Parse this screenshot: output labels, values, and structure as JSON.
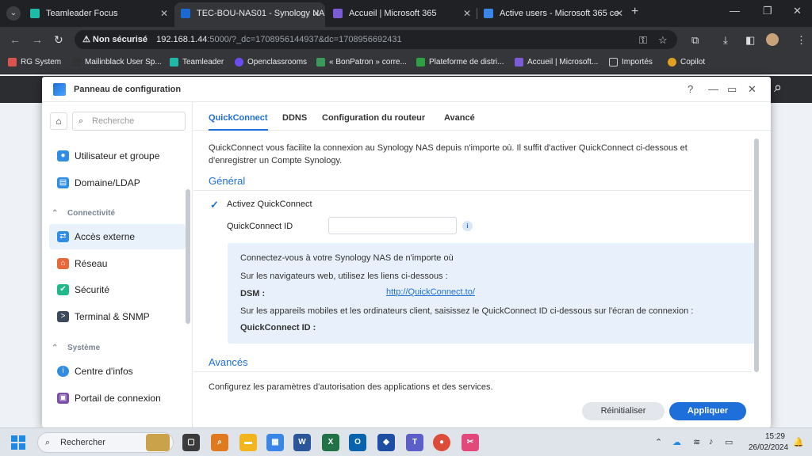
{
  "browser": {
    "tabs": [
      {
        "title": "Teamleader Focus",
        "color": "#1fb9a8"
      },
      {
        "title": "TEC-BOU-NAS01 - Synology NA",
        "color": "#1b6ad4"
      },
      {
        "title": "Accueil | Microsoft 365",
        "color": "#7b5cd6"
      },
      {
        "title": "Active users - Microsoft 365 ce",
        "color": "#3a86e8"
      }
    ],
    "url_warning": "Non sécurisé",
    "url_host": "192.168.1.44",
    "url_rest": ":5000/?_dc=1708956144937&dc=1708956692431",
    "bookmarks": [
      {
        "label": "RG System",
        "color": "#d9534f"
      },
      {
        "label": "Mailinblack User Sp...",
        "color": "#333333"
      },
      {
        "label": "Teamleader",
        "color": "#1fb9a8"
      },
      {
        "label": "Openclassrooms",
        "color": "#6c4cf1"
      },
      {
        "label": "« BonPatron » corre...",
        "color": "#3a9a5b"
      },
      {
        "label": "Plateforme de distri...",
        "color": "#2ea043"
      },
      {
        "label": "Accueil | Microsoft...",
        "color": "#7b5cd6"
      },
      {
        "label": "Importés",
        "color": "#777777"
      },
      {
        "label": "Copilot",
        "color": "#e0a020"
      }
    ]
  },
  "dialog": {
    "title": "Panneau de configuration",
    "sidebar": {
      "search_placeholder": "Recherche",
      "items_top": [
        {
          "label": "Utilisateur et groupe",
          "color": "#2f8de4",
          "glyph": "👥"
        },
        {
          "label": "Domaine/LDAP",
          "color": "#2f8de4",
          "glyph": "▤"
        }
      ],
      "section_connectivity": "Connectivité",
      "items_conn": [
        {
          "label": "Accès externe",
          "color": "#2f8de4",
          "glyph": "⇄"
        },
        {
          "label": "Réseau",
          "color": "#e8683a",
          "glyph": "⌂"
        },
        {
          "label": "Sécurité",
          "color": "#1fb98a",
          "glyph": "✔"
        },
        {
          "label": "Terminal & SNMP",
          "color": "#3b4a5c",
          "glyph": ">"
        }
      ],
      "section_system": "Système",
      "items_sys": [
        {
          "label": "Centre d'infos",
          "color": "#2f8de4",
          "glyph": "i"
        },
        {
          "label": "Portail de connexion",
          "color": "#7b4ea8",
          "glyph": "▣"
        }
      ]
    },
    "tabs": [
      "QuickConnect",
      "DDNS",
      "Configuration du routeur",
      "Avancé"
    ],
    "intro": "QuickConnect vous facilite la connexion au Synology NAS depuis n'importe où. Il suffit d'activer QuickConnect ci-dessous et d'enregistrer un Compte Synology.",
    "general_title": "Général",
    "enable_label": "Activez QuickConnect",
    "qc_id_label": "QuickConnect ID",
    "qc_id_value": "",
    "info": {
      "line1": "Connectez-vous à votre Synology NAS de n'importe où",
      "line2": "Sur les navigateurs web, utilisez les liens ci-dessous :",
      "dsm_label": "DSM :",
      "dsm_link": "http://QuickConnect.to/",
      "line3": "Sur les appareils mobiles et les ordinateurs client, saisissez le QuickConnect ID ci-dessous sur l'écran de connexion :",
      "qc_id_bold": "QuickConnect ID :"
    },
    "advanced_title": "Avancés",
    "advanced_desc": "Configurez les paramètres d'autorisation des applications et des services.",
    "reset_label": "Réinitialiser",
    "apply_label": "Appliquer"
  },
  "taskbar": {
    "search_placeholder": "Rechercher",
    "time": "15:29",
    "date": "26/02/2024",
    "apps": [
      {
        "name": "task-view",
        "color": "#3b3b3b",
        "glyph": "▢"
      },
      {
        "name": "search-app",
        "color": "#e07a1f",
        "glyph": "⌕"
      },
      {
        "name": "file-explorer",
        "color": "#f2b51d",
        "glyph": "▬"
      },
      {
        "name": "store",
        "color": "#3a86e8",
        "glyph": "▦"
      },
      {
        "name": "word",
        "color": "#2b579a",
        "glyph": "W"
      },
      {
        "name": "excel",
        "color": "#217346",
        "glyph": "X"
      },
      {
        "name": "outlook",
        "color": "#0a64ad",
        "glyph": "O"
      },
      {
        "name": "remote-app",
        "color": "#1e4fa3",
        "glyph": "◆"
      },
      {
        "name": "teams",
        "color": "#5b5fc7",
        "glyph": "T"
      },
      {
        "name": "chrome",
        "color": "#dd4b39",
        "glyph": "●"
      },
      {
        "name": "snipping-tool",
        "color": "#e2497a",
        "glyph": "✂"
      }
    ]
  }
}
